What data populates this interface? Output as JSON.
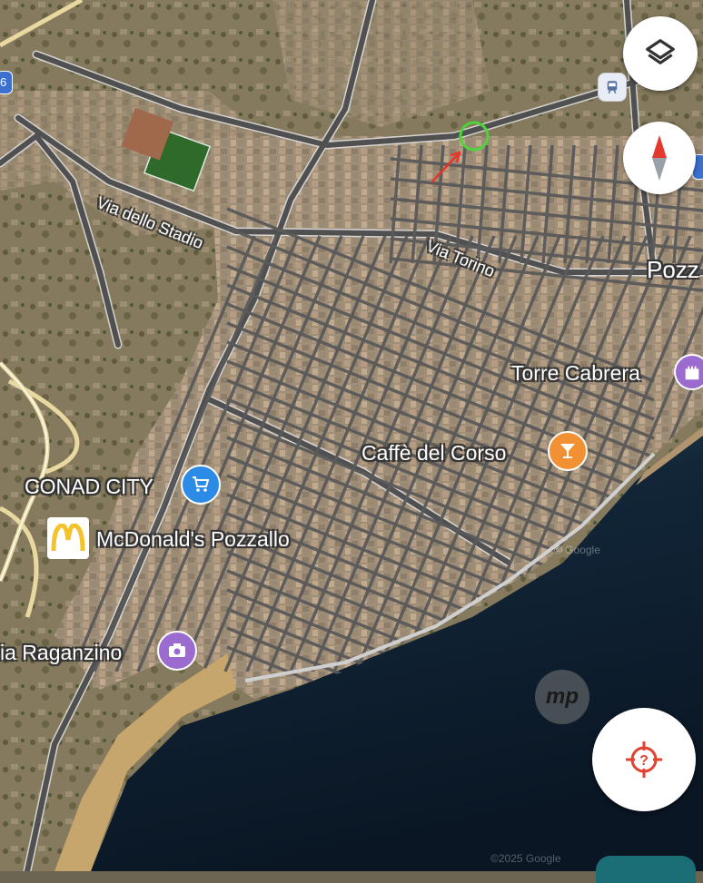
{
  "map": {
    "colors": {
      "sea_deep": "#0c1b2c",
      "sea_shallow": "#2c4956",
      "beach": "#c7a66d",
      "land": "#8a7f65",
      "urban": "#9c8e79",
      "road": "#5a5a5a",
      "road_edge": "#dcdcdc",
      "highway": "#e9d9a0",
      "field_green": "#2f5a2a"
    },
    "streets": {
      "via_dello_stadio": "Via dello Stadio",
      "via_torino": "Via Torino",
      "town_partial": "Pozz"
    },
    "pois": {
      "torre_cabrera": {
        "label": "Torre Cabrera",
        "color": "#9c6bd0",
        "icon": "castle-icon"
      },
      "caffe_del_corso": {
        "label": "Caffè del Corso",
        "color": "#f19134",
        "icon": "cocktail-icon"
      },
      "conad_city": {
        "label": "CONAD CITY",
        "color": "#2b8be6",
        "icon": "shopping-cart-icon"
      },
      "mcdonalds": {
        "label": "McDonald's Pozzallo",
        "color": "#f4c22b",
        "icon": "mcdonalds-logo"
      },
      "raganzino": {
        "label": "ia Raganzino",
        "color": "#9c6bd0",
        "icon": "camera-icon"
      }
    },
    "edge_badge_left": "6",
    "watermark_mp": "mp",
    "watermarks": [
      "© Google",
      "©2025 Google"
    ],
    "annotation": {
      "circle_color": "#4dd43a",
      "arrow_color": "#e8352a"
    }
  },
  "controls": {
    "layers_icon": "layers-icon",
    "compass_icon": "compass-icon",
    "transit_icon": "train-icon",
    "locate_icon": "locate-icon",
    "locate_color": "#e0442f"
  }
}
